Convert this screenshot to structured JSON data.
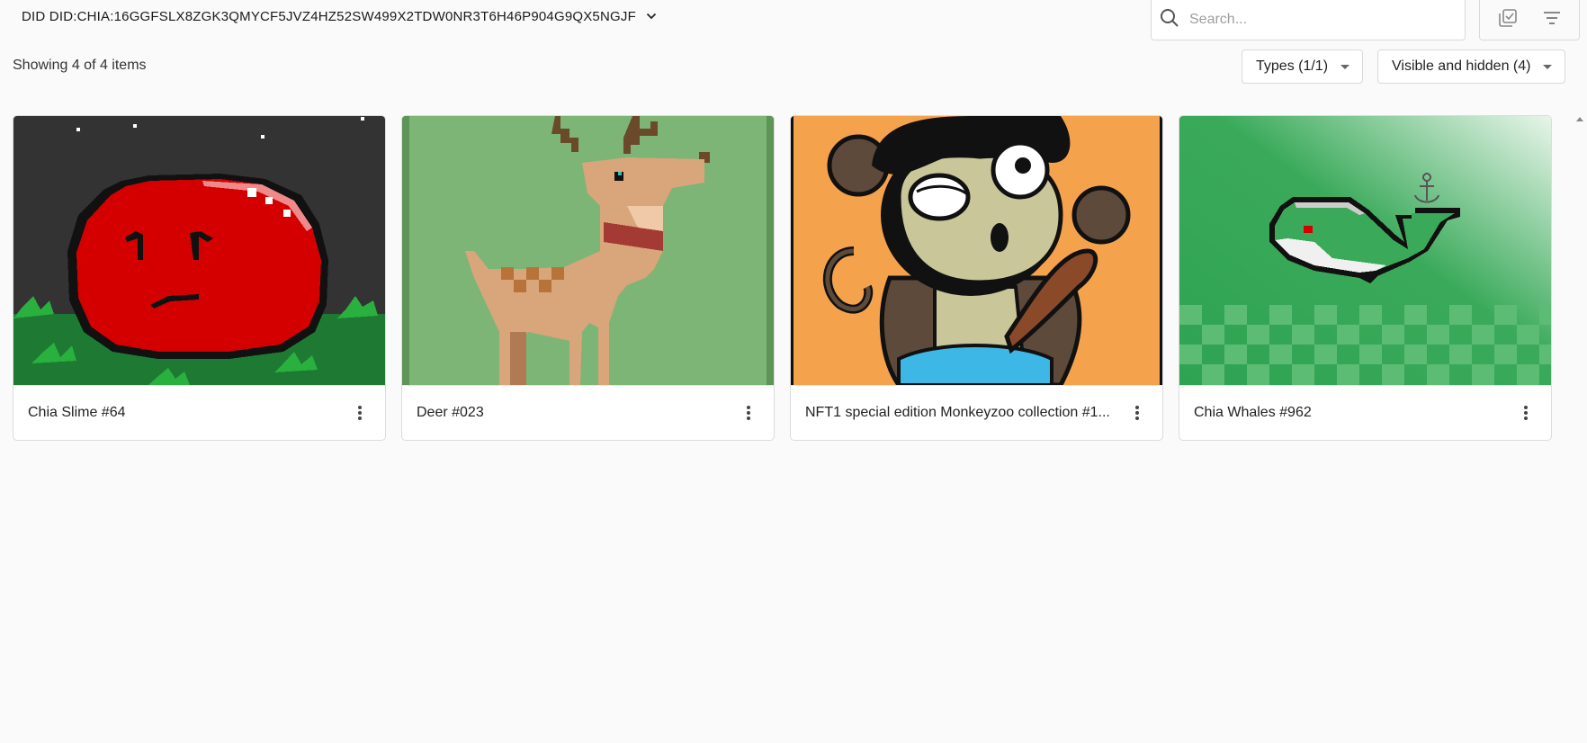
{
  "header": {
    "did_label": "DID DID:CHIA:16GGFSLX8ZGK3QMYCF5JVZ4HZ52SW499X2TDW0NR3T6H46P904G9QX5NGJF",
    "search_placeholder": "Search...",
    "icons": [
      "chevron-down-icon",
      "search-icon",
      "select-multiple-icon",
      "filter-icon"
    ]
  },
  "toolbar": {
    "count_text": "Showing 4 of 4 items",
    "types_filter": "Types (1/1)",
    "visibility_filter": "Visible and hidden (4)"
  },
  "nfts": [
    {
      "title": "Chia Slime #64"
    },
    {
      "title": "Deer #023"
    },
    {
      "title": "NFT1 special edition Monkeyzoo collection #1..."
    },
    {
      "title": "Chia Whales #962"
    }
  ],
  "colors": {
    "slime_bg": "#333333",
    "slime_red": "#d40000",
    "deer_bg": "#7cb575",
    "monkey_bg": "#f5a24d",
    "whale_bg": "#3aaa5a"
  }
}
